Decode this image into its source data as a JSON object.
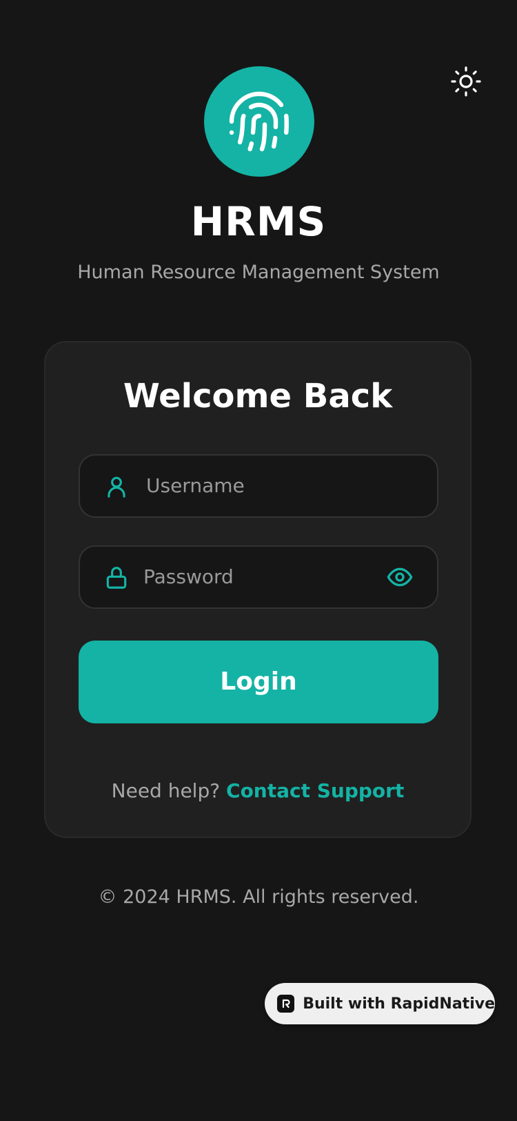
{
  "app": {
    "title": "HRMS",
    "subtitle": "Human Resource Management System"
  },
  "icons": {
    "theme_toggle": "sun-icon",
    "logo": "fingerprint-icon",
    "username": "user-icon",
    "password": "lock-icon",
    "password_visibility": "eye-icon",
    "badge": "rapidnative-logo-icon"
  },
  "colors": {
    "accent": "#14b3a5",
    "background": "#161616",
    "card": "#202020"
  },
  "login_card": {
    "heading": "Welcome Back",
    "username_placeholder": "Username",
    "password_placeholder": "Password",
    "login_label": "Login",
    "help_text": "Need help?",
    "help_link": "Contact Support"
  },
  "footer": {
    "copyright": "© 2024 HRMS. All rights reserved."
  },
  "badge": {
    "label": "Built with RapidNative"
  }
}
